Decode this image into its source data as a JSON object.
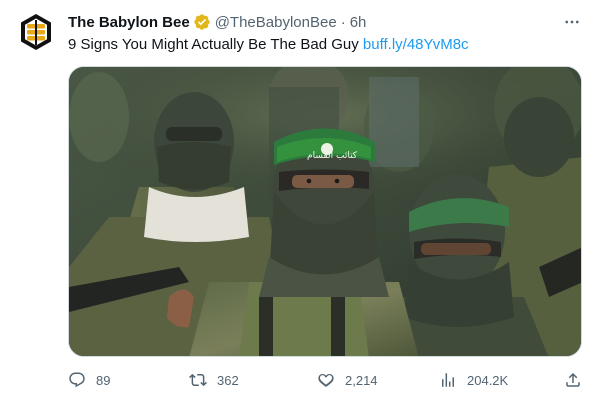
{
  "tweet": {
    "author_name": "The Babylon Bee",
    "handle": "@TheBabylonBee",
    "separator": "·",
    "time": "6h",
    "text": "9 Signs You Might Actually Be The Bad Guy",
    "link": "buff.ly/48YvM8c",
    "verified_badge_color": "#e2b719",
    "link_color": "#1d9bf0"
  },
  "media": {
    "headband_text": "كتائب القسام"
  },
  "actions": {
    "replies": "89",
    "retweets": "362",
    "likes": "2,214",
    "views": "204.2K"
  },
  "icons": [
    "babylon-bee-logo",
    "verified-badge-icon",
    "more-options-icon",
    "reply-icon",
    "retweet-icon",
    "like-icon",
    "views-icon",
    "share-icon"
  ]
}
